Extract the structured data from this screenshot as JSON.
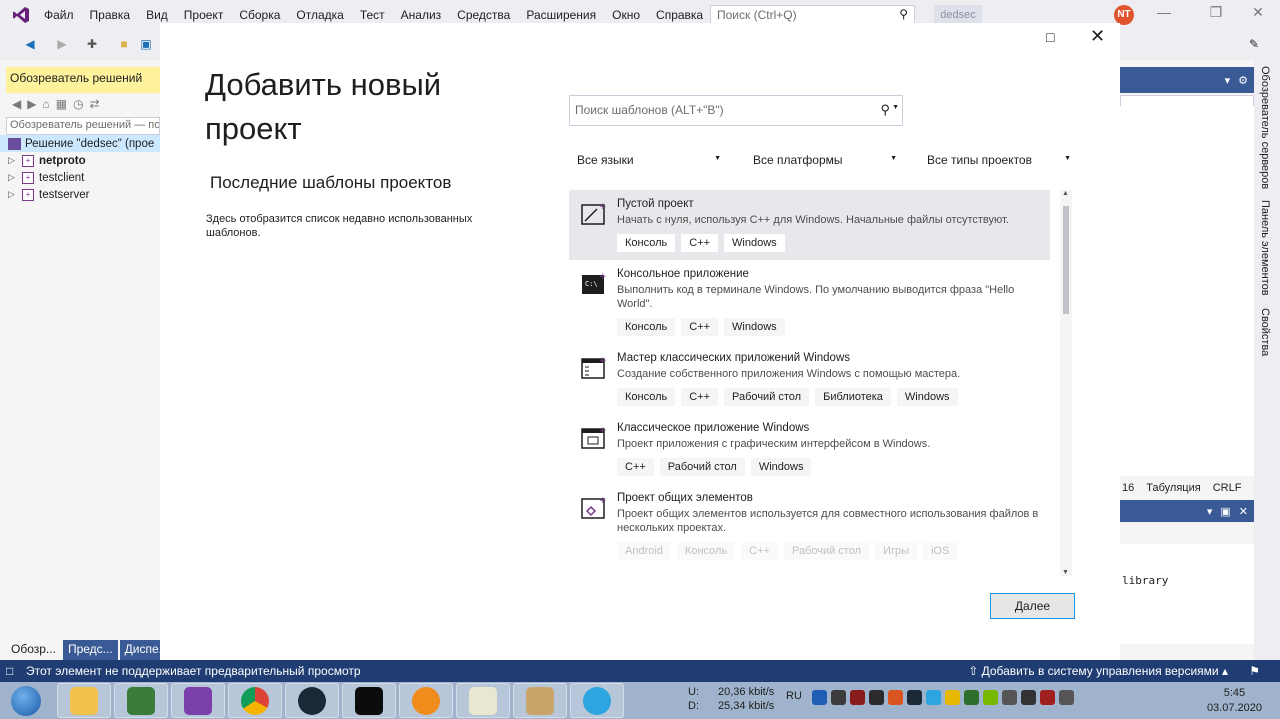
{
  "menubar": {
    "items": [
      "Файл",
      "Правка",
      "Вид",
      "Проект",
      "Сборка",
      "Отладка",
      "Тест",
      "Анализ",
      "Средства",
      "Расширения",
      "Окно",
      "Справка"
    ],
    "search_placeholder": "Поиск (Ctrl+Q)",
    "solution_name": "dedsec",
    "avatar_initials": "NT"
  },
  "solution_explorer": {
    "title": "Обозреватель решений",
    "search_placeholder": "Обозреватель решений — поиск",
    "solution_label": "Решение \"dedsec\" (прое",
    "projects": [
      "netproto",
      "testclient",
      "testserver"
    ],
    "tabs": [
      "Обозр...",
      "Предс...",
      "Диспе..."
    ]
  },
  "editor_status": {
    "col": "16",
    "tabs": "Табуляция",
    "eol": "CRLF"
  },
  "output": {
    "text": "library"
  },
  "side_tabs": [
    "Обозреватель серверов",
    "Панель элементов",
    "Свойства"
  ],
  "statusbar": {
    "message": "Этот элемент не поддерживает предварительный просмотр",
    "version_control": "Добавить в систему управления версиями"
  },
  "dialog": {
    "title": "Добавить новый проект",
    "recent_title": "Последние шаблоны проектов",
    "recent_text": "Здесь отобразится список недавно использованных шаблонов.",
    "search_placeholder": "Поиск шаблонов (ALT+\"В\")",
    "filters": {
      "language": "Все языки",
      "platform": "Все платформы",
      "project_type": "Все типы проектов"
    },
    "templates": [
      {
        "name": "Пустой проект",
        "desc": "Начать с нуля, используя C++ для Windows. Начальные файлы отсутствуют.",
        "tags": [
          "Консоль",
          "C++",
          "Windows"
        ],
        "selected": true
      },
      {
        "name": "Консольное приложение",
        "desc": "Выполнить код в терминале Windows. По умолчанию выводится фраза \"Hello World\".",
        "tags": [
          "Консоль",
          "C++",
          "Windows"
        ]
      },
      {
        "name": "Мастер классических приложений Windows",
        "desc": "Создание собственного приложения Windows с помощью мастера.",
        "tags": [
          "Консоль",
          "C++",
          "Рабочий стол",
          "Библиотека",
          "Windows"
        ]
      },
      {
        "name": "Классическое приложение Windows",
        "desc": "Проект приложения с графическим интерфейсом в Windows.",
        "tags": [
          "C++",
          "Рабочий стол",
          "Windows"
        ]
      },
      {
        "name": "Проект общих элементов",
        "desc": "Проект общих элементов используется для совместного использования файлов в нескольких проектах.",
        "tags": [
          "Android",
          "Консоль",
          "C++",
          "Рабочий стол",
          "Игры",
          "iOS"
        ]
      }
    ],
    "next_label": "Далее"
  },
  "taskbar": {
    "net_up_label": "U:",
    "net_up": "20,36 kbit/s",
    "net_down_label": "D:",
    "net_down": "25,34 kbit/s",
    "lang": "RU",
    "time": "5:45",
    "date": "03.07.2020"
  },
  "colors": {
    "accent": "#1c97ea",
    "statusbar": "#1f3d73",
    "panel_header": "#3a5a96",
    "highlight_header": "#fff29d"
  }
}
